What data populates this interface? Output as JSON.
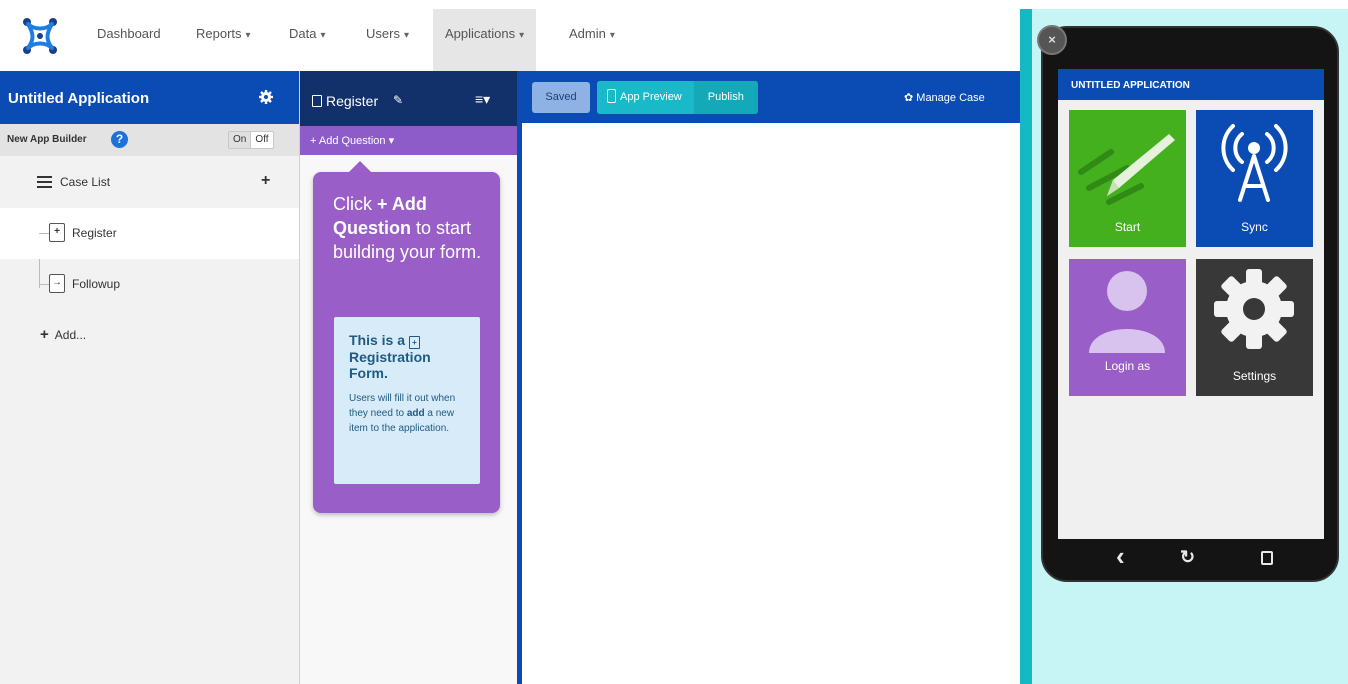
{
  "topnav": {
    "items": [
      {
        "label": "Dashboard",
        "has_caret": false
      },
      {
        "label": "Reports",
        "has_caret": true
      },
      {
        "label": "Data",
        "has_caret": true
      },
      {
        "label": "Users",
        "has_caret": true
      },
      {
        "label": "Applications",
        "has_caret": true,
        "active": true
      },
      {
        "label": "Admin",
        "has_caret": true
      }
    ],
    "caret": "▾"
  },
  "sidebar": {
    "app_title": "Untitled Application",
    "builder_label": "New App Builder",
    "help_icon": "?",
    "toggle_on": "On",
    "toggle_off": "Off",
    "case_list_label": "Case List",
    "case_add": "+",
    "forms": [
      {
        "label": "Register",
        "icon": "+",
        "selected": true
      },
      {
        "label": "Followup",
        "icon": "→",
        "selected": false
      }
    ],
    "add_label": "Add...",
    "add_plus": "+"
  },
  "form": {
    "name": "Register",
    "add_question": "+ Add Question ▾",
    "menu": "≡▾",
    "pencil": "✎",
    "popover": {
      "line1_prefix": "Click ",
      "line1_bold": "+ Add Question",
      "line1_suffix": " to start building your form.",
      "info_title": "This is a ",
      "info_title_icon": "+",
      "info_title_suffix": " Registration Form.",
      "info_body_prefix": "Users will fill it out when they need to ",
      "info_body_bold": "add",
      "info_body_suffix": " a new item to the application."
    }
  },
  "toolbar": {
    "saved": "Saved",
    "app_preview": "App Preview",
    "publish": "Publish",
    "manage_case": "Manage Case",
    "manage_icon": "✿"
  },
  "preview": {
    "close": "×",
    "app_bar_title": "UNTITLED APPLICATION",
    "tiles": {
      "start": "Start",
      "sync": "Sync",
      "login": "Login as",
      "settings": "Settings"
    },
    "nav": {
      "back": "‹",
      "refresh": "↻"
    }
  },
  "colors": {
    "brand_blue": "#0a4cb4",
    "form_purple": "#9a5ec9",
    "teal": "#19b9c9",
    "tile_green": "#44b01e",
    "tile_dark": "#383838"
  }
}
